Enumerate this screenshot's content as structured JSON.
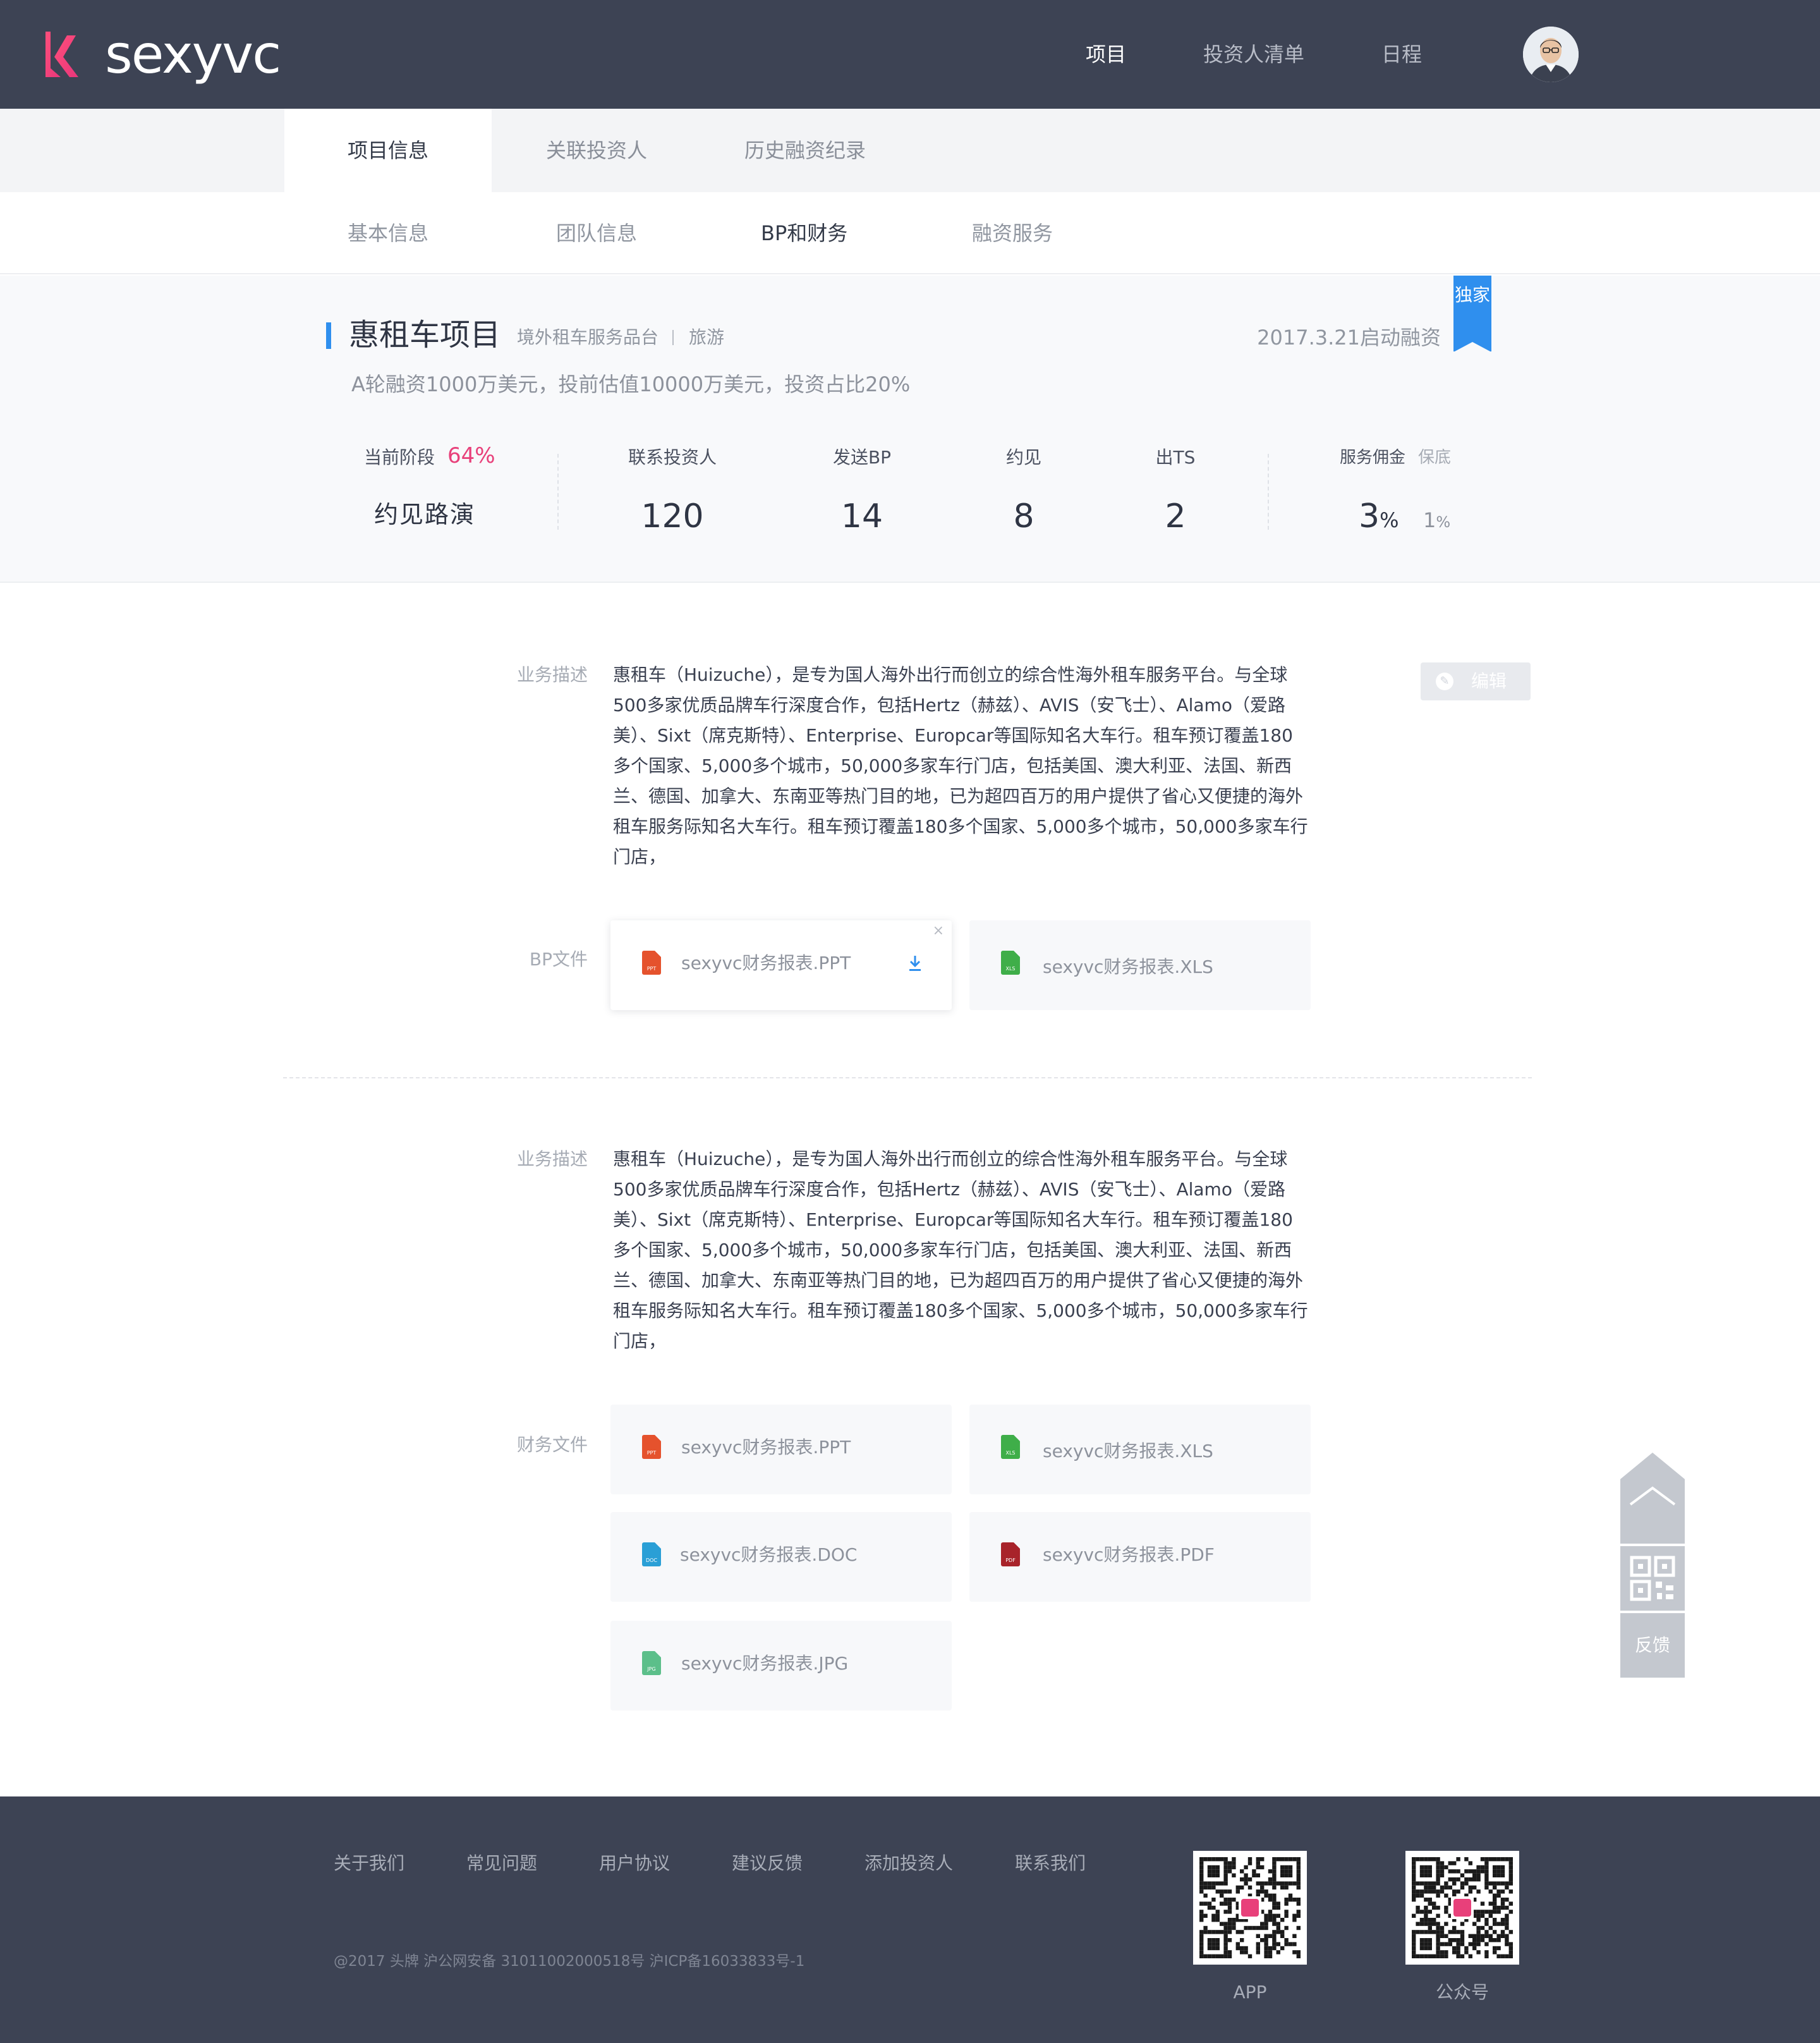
{
  "header": {
    "logo_text": "sexyvc",
    "nav": [
      "项目",
      "投资人清单",
      "日程"
    ],
    "avatar_icon": "user-avatar"
  },
  "tabs_primary": [
    "项目信息",
    "关联投资人",
    "历史融资纪录"
  ],
  "tabs_secondary": [
    "基本信息",
    "团队信息",
    "BP和财务",
    "融资服务"
  ],
  "project": {
    "name": "惠租车项目",
    "tags": [
      "境外租车服务品台",
      "旅游"
    ],
    "date": "2017.3.21启动融资",
    "badge": "独家",
    "subtitle": "A轮融资1000万美元，投前估值10000万美元，投资占比20%"
  },
  "stats": {
    "stage_label": "当前阶段",
    "stage_pct": "64%",
    "stage_value": "约见路演",
    "items": [
      {
        "label": "联系投资人",
        "value": "120"
      },
      {
        "label": "发送BP",
        "value": "14"
      },
      {
        "label": "约见",
        "value": "8"
      },
      {
        "label": "出TS",
        "value": "2"
      }
    ],
    "fee_label": "服务佣金",
    "fee_guarantee_label": "保底",
    "fee_value": "3",
    "fee_unit": "%",
    "fee_guarantee_value": "1",
    "fee_guarantee_unit": "%"
  },
  "section1": {
    "desc_label": "业务描述",
    "desc": "惠租车（Huizuche），是专为国人海外出行而创立的综合性海外租车服务平台。与全球500多家优质品牌车行深度合作，包括Hertz（赫兹）、AVIS（安飞士）、Alamo（爱路美）、Sixt（席克斯特）、Enterprise、Europcar等国际知名大车行。租车预订覆盖180多个国家、5,000多个城市，50,000多家车行门店，包括美国、澳大利亚、法国、新西兰、德国、加拿大、东南亚等热门目的地，已为超四百万的用户提供了省心又便捷的海外租车服务际知名大车行。租车预订覆盖180多个国家、5,000多个城市，50,000多家车行门店，",
    "edit_label": "编辑",
    "files_label": "BP文件",
    "files": [
      {
        "name": "sexyvc财务报表.PPT",
        "ext": "PPT",
        "color": "#e5522d"
      },
      {
        "name": "sexyvc财务报表.XLS",
        "ext": "XLS",
        "color": "#3fae49"
      }
    ],
    "close_glyph": "×"
  },
  "section2": {
    "desc_label": "业务描述",
    "desc": "惠租车（Huizuche），是专为国人海外出行而创立的综合性海外租车服务平台。与全球500多家优质品牌车行深度合作，包括Hertz（赫兹）、AVIS（安飞士）、Alamo（爱路美）、Sixt（席克斯特）、Enterprise、Europcar等国际知名大车行。租车预订覆盖180多个国家、5,000多个城市，50,000多家车行门店，包括美国、澳大利亚、法国、新西兰、德国、加拿大、东南亚等热门目的地，已为超四百万的用户提供了省心又便捷的海外租车服务际知名大车行。租车预订覆盖180多个国家、5,000多个城市，50,000多家车行门店，",
    "files_label": "财务文件",
    "files": [
      {
        "name": "sexyvc财务报表.PPT",
        "ext": "PPT",
        "color": "#e5522d"
      },
      {
        "name": "sexyvc财务报表.XLS",
        "ext": "XLS",
        "color": "#3fae49"
      },
      {
        "name": "sexyvc财务报表.DOC",
        "ext": "DOC",
        "color": "#2a9fd6"
      },
      {
        "name": "sexyvc财务报表.PDF",
        "ext": "PDF",
        "color": "#a8232a"
      },
      {
        "name": "sexyvc财务报表.JPG",
        "ext": "JPG",
        "color": "#5cbf8a"
      }
    ]
  },
  "side": {
    "feedback": "反馈"
  },
  "footer": {
    "links": [
      "关于我们",
      "常见问题",
      "用户协议",
      "建议反馈",
      "添加投资人",
      "联系我们"
    ],
    "copyright": "@2017 头牌   沪公网安备 31011002000518号  沪ICP备16033833号-1",
    "qr": [
      "APP",
      "公众号"
    ]
  },
  "colors": {
    "header_bg": "#3d4354",
    "accent_blue": "#2f8fee",
    "accent_pink": "#e8407a"
  }
}
